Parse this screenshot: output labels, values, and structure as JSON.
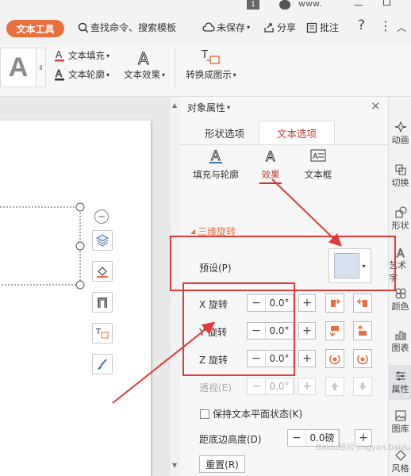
{
  "titlebar": {
    "page_number": "1",
    "user": "www."
  },
  "toolbar": {
    "tool_tab": "文本工具",
    "search": "查找命令、搜索模板",
    "unsaved": "未保存",
    "share": "分享",
    "comment": "批注",
    "help": "?",
    "more": "⋮"
  },
  "ribbon": {
    "style_letter": "A",
    "text_fill": "文本填充",
    "text_outline": "文本轮廓",
    "text_effect": "文本效果",
    "convert": "转换成图示"
  },
  "panel": {
    "title": "对象属性",
    "tabs": [
      "形状选项",
      "文本选项"
    ],
    "subtabs": [
      "填充与轮廓",
      "效果",
      "文本框"
    ],
    "section": "三维旋转",
    "preset_label": "预设(P)",
    "rows": [
      {
        "label": "X 旋转",
        "value": "0.0°"
      },
      {
        "label": "Y 旋转",
        "value": "0.0°"
      },
      {
        "label": "Z 旋转",
        "value": "0.0°"
      }
    ],
    "perspective_label": "透视(E)",
    "perspective_value": "0.0°",
    "keep_flat": "保持文本平面状态(K)",
    "base_height_label": "距底边高度(D)",
    "base_height_value": "0.0磅",
    "reset": "重置(R)"
  },
  "rightbar": [
    "动画",
    "切换",
    "形状",
    "艺术字",
    "颜色",
    "图表",
    "属性",
    "图库",
    "风格"
  ],
  "watermark": "Baidu经验 jingyan.baidu.com",
  "colors": {
    "accent": "#e9703d",
    "annotation": "#e03a3a",
    "selected_tab": "#c0392b"
  }
}
